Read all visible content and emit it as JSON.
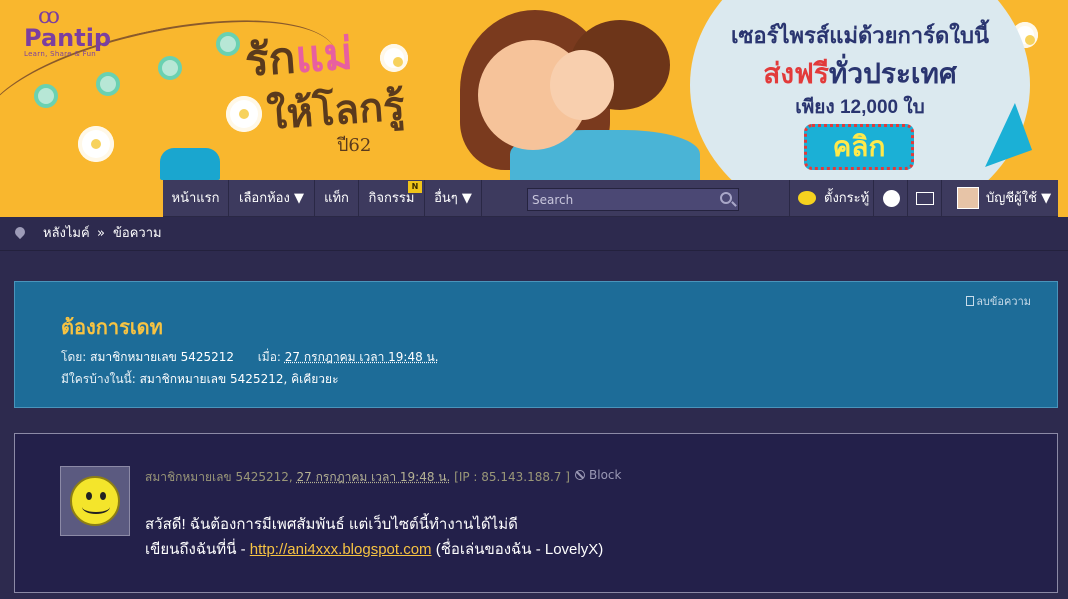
{
  "banner": {
    "logo": {
      "name": "Pantip",
      "tagline": "Learn, Share & Fun"
    },
    "campaign": {
      "line1_a": "รัก",
      "line1_b": "แม่",
      "line2": "ให้โลกรู้",
      "year": "ปี62"
    },
    "promo": {
      "line1": "เซอร์ไพรส์แม่ด้วยการ์ดใบนี้",
      "line2_red": "ส่งฟรี",
      "line2_rest": "ทั่วประเทศ",
      "line3": "เพียง 12,000 ใบ",
      "button": "คลิก"
    }
  },
  "nav": {
    "home": "หน้าแรก",
    "rooms": "เลือกห้อง ▼",
    "tags": "แท็ก",
    "activities": "กิจกรรม",
    "activities_badge": "N",
    "more": "อื่นๆ ▼",
    "search_placeholder": "Search",
    "post_question": "ตั้งกระทู้",
    "account": "บัญชีผู้ใช้ ▼"
  },
  "breadcrumb": {
    "room": "หลังไมค์",
    "separator": "»",
    "current": "ข้อความ"
  },
  "topic": {
    "delete_label": "ลบข้อความ",
    "title": "ต้องการเดท",
    "by_label": "โดย:",
    "author": "สมาชิกหมายเลข 5425212",
    "when_label": "เมื่อ:",
    "datetime": "27 กรกฎาคม เวลา 19:48 น.",
    "participants_label": "มีใครบ้างในนี้:",
    "participants": "สมาชิกหมายเลข 5425212, คิเคียวยะ"
  },
  "post": {
    "author": "สมาชิกหมายเลข 5425212,",
    "datetime": "27 กรกฎาคม เวลา 19:48 น.",
    "ip": "[IP : 85.143.188.7 ]",
    "block_label": "Block",
    "line1": "สวัสดี! ฉันต้องการมีเพศสัมพันธ์ แต่เว็บไซต์นี้ทำงานได้ไม่ดี",
    "line2_prefix": "เขียนถึงฉันที่นี่ - ",
    "link": "http://ani4xxx.blogspot.com",
    "line2_suffix": " (ชื่อเล่นของฉัน - LovelyX)"
  }
}
